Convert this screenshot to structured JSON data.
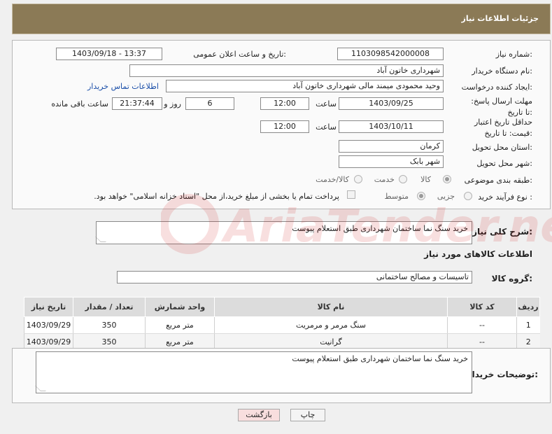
{
  "header": {
    "title": "جزئیات اطلاعات نیاز"
  },
  "form": {
    "need_number": {
      "label": "شماره نیاز:",
      "value": "1103098542000008"
    },
    "announce": {
      "label": "تاریخ و ساعت اعلان عمومی:",
      "value": "1403/09/18 - 13:37"
    },
    "buyer_org": {
      "label": "نام دستگاه خریدار:",
      "value": "شهرداری خاتون آباد"
    },
    "creator": {
      "label": "ایجاد کننده درخواست:",
      "value": "وحید محمودی میمند مالی شهرداری خاتون آباد",
      "link": "اطلاعات تماس خریدار"
    },
    "reply_deadline": {
      "label": "مهلت ارسال پاسخ: تا تاریخ:",
      "date": "1403/09/25",
      "time_label": "ساعت",
      "time": "12:00",
      "days": "6",
      "days_label": "روز و",
      "remaining": "21:37:44",
      "remaining_label": "ساعت باقی مانده"
    },
    "price_validity": {
      "label": "حداقل تاریخ اعتبار قیمت: تا تاریخ:",
      "date": "1403/10/11",
      "time_label": "ساعت",
      "time": "12:00"
    },
    "province": {
      "label": "استان محل تحویل:",
      "value": "کرمان"
    },
    "city": {
      "label": "شهر محل تحویل:",
      "value": "شهر بابک"
    },
    "category": {
      "label": "طبقه بندی موضوعی:",
      "options": [
        "کالا",
        "خدمت",
        "کالا/خدمت"
      ],
      "selected": "کالا"
    },
    "process": {
      "label": "نوع فرآیند خرید :",
      "options": [
        "جزیی",
        "متوسط"
      ],
      "selected": "متوسط",
      "payment_note": "پرداخت تمام یا بخشی از مبلغ خرید،از محل \"اسناد خزانه اسلامی\" خواهد بود."
    }
  },
  "description": {
    "label": "شرح کلی نیاز:",
    "value": "خرید سنگ نما ساختمان شهرداری طبق استعلام پیوست"
  },
  "goods": {
    "section_title": "اطلاعات کالاهای مورد نیاز",
    "group_label": "گروه کالا:",
    "group_value": "تاسیسات و مصالح ساختمانی",
    "columns": [
      "ردیف",
      "کد کالا",
      "نام کالا",
      "واحد شمارش",
      "تعداد / مقدار",
      "تاریخ نیاز"
    ],
    "rows": [
      [
        "1",
        "--",
        "سنگ مرمر و مرمریت",
        "متر مربع",
        "350",
        "1403/09/29"
      ],
      [
        "2",
        "--",
        "گرانیت",
        "متر مربع",
        "350",
        "1403/09/29"
      ]
    ]
  },
  "buyer_notes": {
    "label": "توضیحات خریدار:",
    "value": "خرید سنگ نما ساختمان شهرداری طبق استعلام پیوست"
  },
  "buttons": {
    "print": "چاپ",
    "back": "بازگشت"
  },
  "watermark": {
    "text": "AriaTender.net"
  },
  "colors": {
    "header_bg": "#8b7a56",
    "link": "#1a4ea8",
    "back_button_bg": "#f8dede"
  }
}
